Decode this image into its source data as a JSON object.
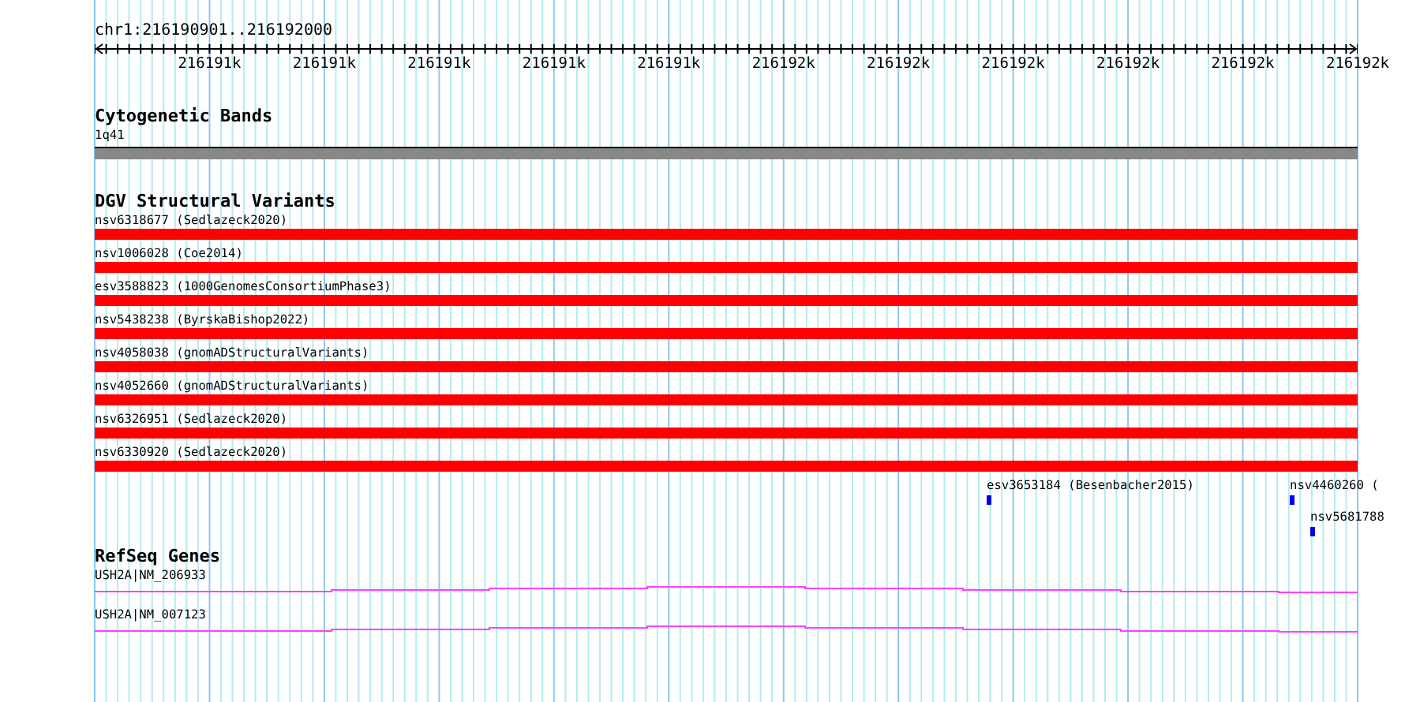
{
  "location": "chr1:216190901..216192000",
  "ruler": {
    "ticks": [
      "216191k",
      "216191k",
      "216191k",
      "216191k",
      "216191k",
      "216192k",
      "216192k",
      "216192k",
      "216192k",
      "216192k",
      "216192k"
    ]
  },
  "tracks": [
    {
      "kind": "bands",
      "title": "Cytogenetic Bands",
      "features": [
        {
          "label": "1q41"
        }
      ]
    },
    {
      "kind": "variants",
      "title": "DGV Structural Variants",
      "features": [
        {
          "label": "nsv6318677 (Sedlazeck2020)"
        },
        {
          "label": "nsv1006028 (Coe2014)"
        },
        {
          "label": "esv3588823 (1000GenomesConsortiumPhase3)"
        },
        {
          "label": "nsv5438238 (ByrskaBishop2022)"
        },
        {
          "label": "nsv4058038 (gnomADStructuralVariants)"
        },
        {
          "label": "nsv4052660 (gnomADStructuralVariants)"
        },
        {
          "label": "nsv6326951 (Sedlazeck2020)"
        },
        {
          "label": "nsv6330920 (Sedlazeck2020)"
        }
      ],
      "small_features": [
        {
          "label": "esv3653184 (Besenbacher2015)"
        },
        {
          "label": "nsv4460260 ("
        },
        {
          "label": "nsv5681788"
        }
      ]
    },
    {
      "kind": "genes",
      "title": "RefSeq Genes",
      "features": [
        {
          "label": "USH2A|NM_206933"
        },
        {
          "label": "USH2A|NM_007123"
        }
      ]
    }
  ]
}
